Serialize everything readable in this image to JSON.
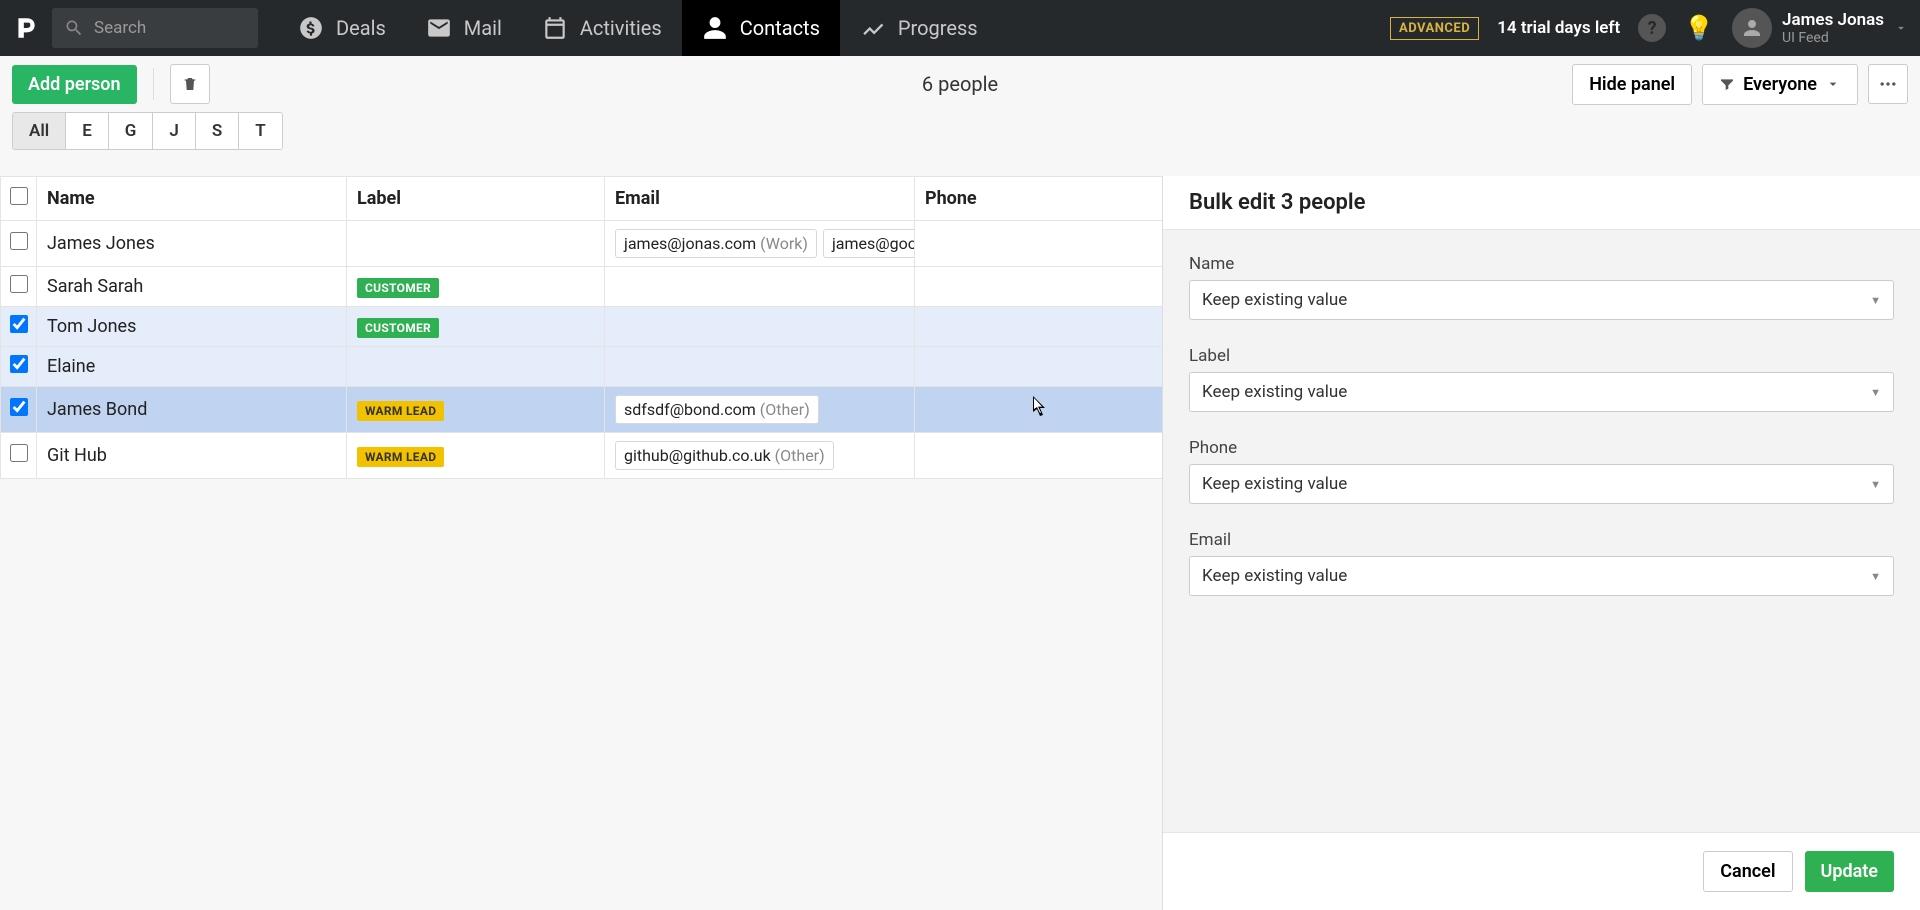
{
  "nav": {
    "search_placeholder": "Search",
    "items": [
      {
        "label": "Deals"
      },
      {
        "label": "Mail"
      },
      {
        "label": "Activities"
      },
      {
        "label": "Contacts"
      },
      {
        "label": "Progress"
      }
    ],
    "badge": "ADVANCED",
    "trial": "14 trial days left",
    "user_name": "James Jonas",
    "user_sub": "UI Feed"
  },
  "toolbar": {
    "add_label": "Add person",
    "count": "6 people",
    "hide_panel": "Hide panel",
    "filter_label": "Everyone"
  },
  "alpha": [
    "All",
    "E",
    "G",
    "J",
    "S",
    "T"
  ],
  "table": {
    "headers": {
      "name": "Name",
      "label": "Label",
      "email": "Email",
      "phone": "Phone"
    },
    "rows": [
      {
        "selected": false,
        "name": "James Jones",
        "label": null,
        "emails": [
          {
            "addr": "james@jonas.com",
            "type": "Work"
          },
          {
            "addr": "james@goog",
            "type": ""
          }
        ]
      },
      {
        "selected": false,
        "name": "Sarah Sarah",
        "label": "CUSTOMER",
        "label_class": "lbl-customer",
        "emails": []
      },
      {
        "selected": true,
        "name": "Tom Jones",
        "label": "CUSTOMER",
        "label_class": "lbl-customer",
        "emails": []
      },
      {
        "selected": true,
        "name": "Elaine",
        "label": null,
        "emails": []
      },
      {
        "selected": true,
        "hover": true,
        "name": "James Bond",
        "label": "WARM LEAD",
        "label_class": "lbl-warm",
        "emails": [
          {
            "addr": "sdfsdf@bond.com",
            "type": "Other"
          }
        ]
      },
      {
        "selected": false,
        "name": "Git Hub",
        "label": "WARM LEAD",
        "label_class": "lbl-warm",
        "emails": [
          {
            "addr": "github@github.co.uk",
            "type": "Other"
          }
        ]
      }
    ]
  },
  "panel": {
    "title": "Bulk edit 3 people",
    "fields": [
      {
        "label": "Name",
        "value": "Keep existing value"
      },
      {
        "label": "Label",
        "value": "Keep existing value"
      },
      {
        "label": "Phone",
        "value": "Keep existing value"
      },
      {
        "label": "Email",
        "value": "Keep existing value"
      }
    ],
    "cancel": "Cancel",
    "update": "Update"
  }
}
